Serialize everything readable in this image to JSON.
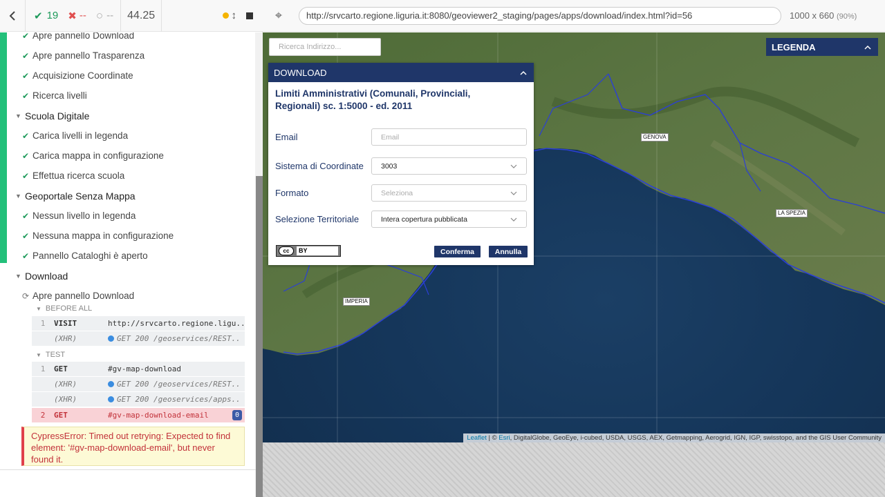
{
  "reporter": {
    "stats": {
      "passed": "19",
      "failed": "--",
      "pending": "--",
      "duration": "44.25"
    },
    "rows": [
      {
        "kind": "test",
        "label": "Apre pannello Download"
      },
      {
        "kind": "test",
        "label": "Apre pannello Trasparenza"
      },
      {
        "kind": "test",
        "label": "Acquisizione Coordinate"
      },
      {
        "kind": "test",
        "label": "Ricerca livelli"
      },
      {
        "kind": "suite",
        "label": "Scuola Digitale"
      },
      {
        "kind": "test",
        "label": "Carica livelli in legenda"
      },
      {
        "kind": "test",
        "label": "Carica mappa in configurazione"
      },
      {
        "kind": "test",
        "label": "Effettua ricerca scuola"
      },
      {
        "kind": "suite",
        "label": "Geoportale Senza Mappa"
      },
      {
        "kind": "test",
        "label": "Nessun livello in legenda"
      },
      {
        "kind": "test",
        "label": "Nessuna mappa in configurazione"
      },
      {
        "kind": "test",
        "label": "Pannello Cataloghi è aperto"
      },
      {
        "kind": "suite",
        "label": "Download"
      },
      {
        "kind": "running",
        "label": "Apre pannello Download"
      }
    ],
    "before_all_label": "BEFORE ALL",
    "test_label": "TEST",
    "before_all_cmds": [
      {
        "num": "1",
        "name": "VISIT",
        "msg": "http://srvcarto.regione.ligu..",
        "xhr": false
      },
      {
        "num": "",
        "name": "(XHR)",
        "msg": "GET 200 /geoservices/REST..",
        "xhr": true
      }
    ],
    "test_cmds": [
      {
        "num": "1",
        "name": "GET",
        "msg": "#gv-map-download",
        "xhr": false
      },
      {
        "num": "",
        "name": "(XHR)",
        "msg": "GET 200 /geoservices/REST..",
        "xhr": true
      },
      {
        "num": "",
        "name": "(XHR)",
        "msg": "GET 200 /geoservices/apps..",
        "xhr": true
      }
    ],
    "failed_cmd": {
      "num": "2",
      "name": "GET",
      "msg": "#gv-map-download-email",
      "badge": "0"
    },
    "error": "CypressError: Timed out retrying: Expected to find element: '#gv-map-download-email', but never found it."
  },
  "browser": {
    "url": "http://srvcarto.regione.liguria.it:8080/geoviewer2_staging/pages/apps/download/index.html?id=56",
    "viewport": "1000 x 660",
    "zoom": "(90%)"
  },
  "map": {
    "search_placeholder": "Ricerca Indirizzo...",
    "legend_label": "LEGENDA",
    "cities": [
      "GENOVA",
      "LA SPEZIA",
      "IMPERIA"
    ],
    "attribution_leaflet": "Leaflet",
    "attribution_esri": "Esri",
    "attribution_rest": ", DigitalGlobe, GeoEye, i-cubed, USDA, USGS, AEX, Getmapping, Aerogrid, IGN, IGP, swisstopo, and the GIS User Community",
    "attribution_sep": " | © "
  },
  "dialog": {
    "header": "DOWNLOAD",
    "title": "Limiti Amministrativi (Comunali, Provinciali, Regionali) sc. 1:5000 - ed. 2011",
    "email_label": "Email",
    "email_placeholder": "Email",
    "crs_label": "Sistema di Coordinate",
    "crs_value": "3003",
    "format_label": "Formato",
    "format_placeholder": "Seleziona",
    "territory_label": "Selezione Territoriale",
    "territory_value": "Intera copertura pubblicata",
    "license_cc": "cc",
    "license_by": "BY",
    "confirm_label": "Conferma",
    "cancel_label": "Annulla"
  },
  "colors": {
    "accent": "#1f3669",
    "pass": "#1e9a5b",
    "fail": "#c2323a"
  }
}
